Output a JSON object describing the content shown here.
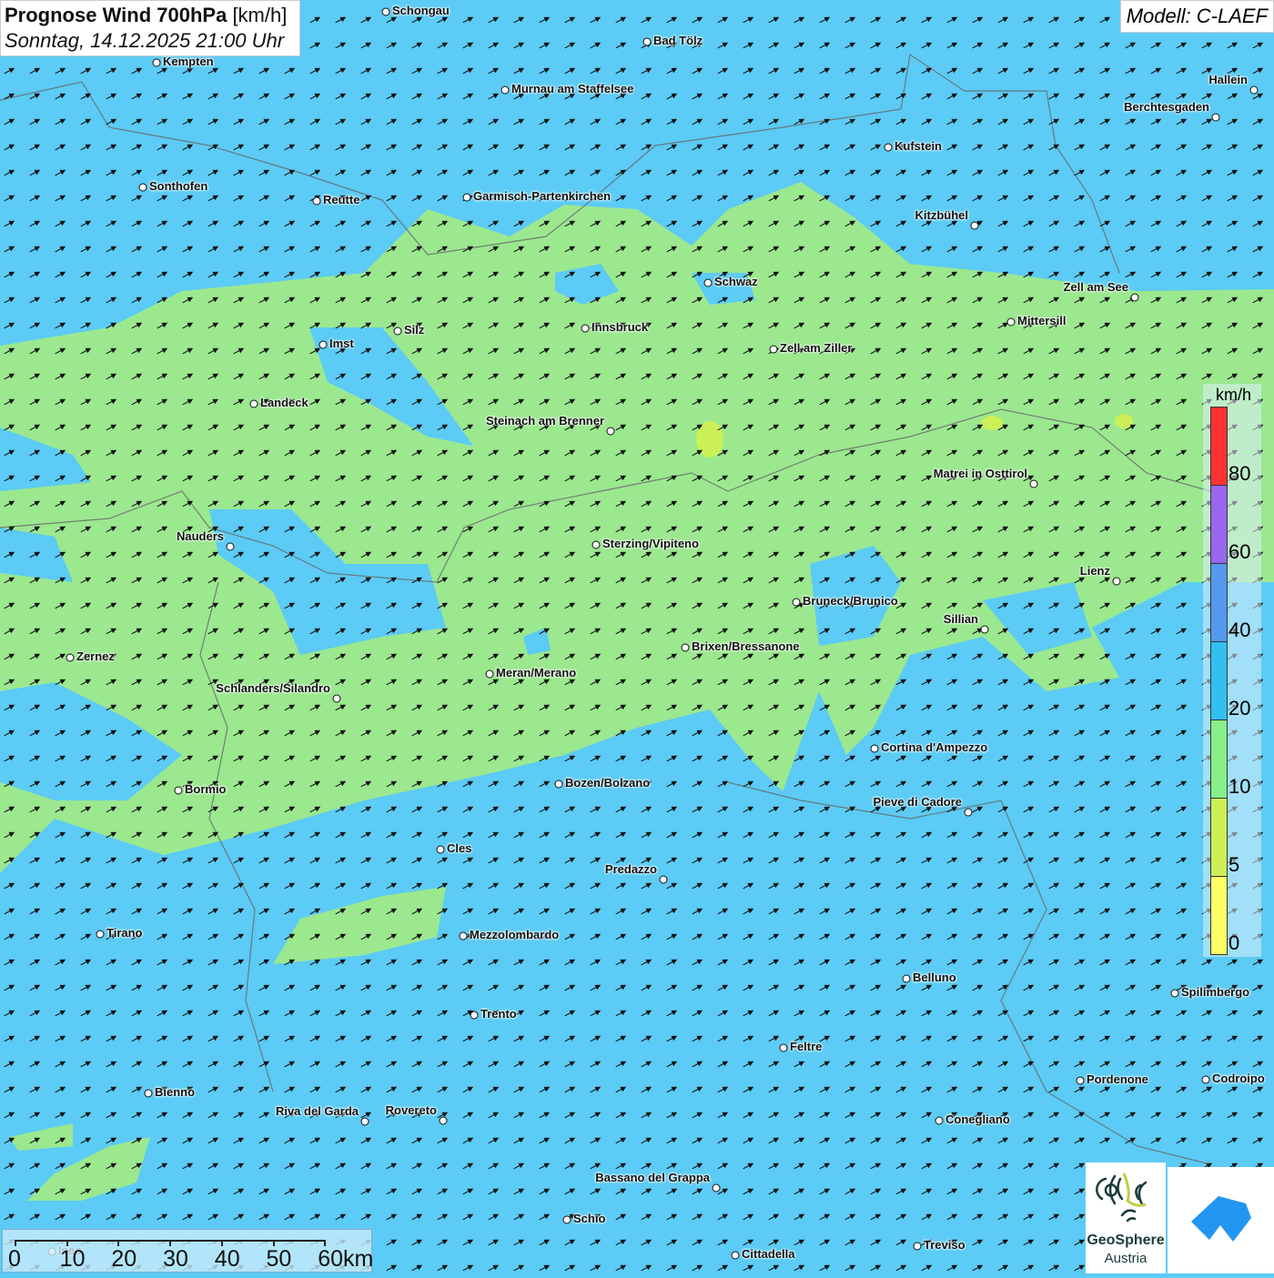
{
  "header": {
    "title_bold": "Prognose Wind 700hPa",
    "title_unit": "[km/h]",
    "datetime": "Sonntag, 14.12.2025 21:00 Uhr",
    "model": "Modell: C-LAEF"
  },
  "legend": {
    "unit": "km/h",
    "labels": [
      "80",
      "60",
      "40",
      "20",
      "10",
      "5",
      "0"
    ],
    "colors": [
      "#ff3333",
      "#9966ee",
      "#5599ee",
      "#33c0f0",
      "#88ee88",
      "#ccf055",
      "#ffff66"
    ]
  },
  "scale_bar": {
    "labels": [
      "0",
      "10",
      "20",
      "30",
      "40",
      "50",
      "60km"
    ]
  },
  "cities": [
    "Schongau",
    "Bad Tölz",
    "Kempten",
    "Murnau am Staffelsee",
    "Hallein",
    "Berchtesgaden",
    "Kufstein",
    "Sonthofen",
    "Reutte",
    "Garmisch-Partenkirchen",
    "Kitzbühel",
    "Schwaz",
    "Zell am See",
    "Innsbruck",
    "Mittersill",
    "Silz",
    "Imst",
    "Zell am Ziller",
    "Landeck",
    "Steinach am Brenner",
    "Matrei in Osttirol",
    "Nauders",
    "Sterzing/Vipiteno",
    "Lienz",
    "Bruneck/Brunico",
    "Sillian",
    "Brixen/Bressanone",
    "Zernez",
    "Meran/Merano",
    "Schlanders/Silandro",
    "Cortina d'Ampezzo",
    "Bozen/Bolzano",
    "Bormio",
    "Pieve di Cadore",
    "Cles",
    "Predazzo",
    "Tirano",
    "Mezzolombardo",
    "Belluno",
    "Spilimbergo",
    "Trento",
    "Feltre",
    "Pordenone",
    "Codroipo",
    "Bienno",
    "Riva del Garda",
    "Rovereto",
    "Conegliano",
    "Bassano del Grappa",
    "Schio",
    "Treviso",
    "Cittadella",
    "Iseo"
  ],
  "logos": {
    "geosphere_line1": "GeoSphere",
    "geosphere_line2": "Austria"
  },
  "colors": {
    "water_blue": "#5ccbf5",
    "calm_green": "#9be88f"
  }
}
